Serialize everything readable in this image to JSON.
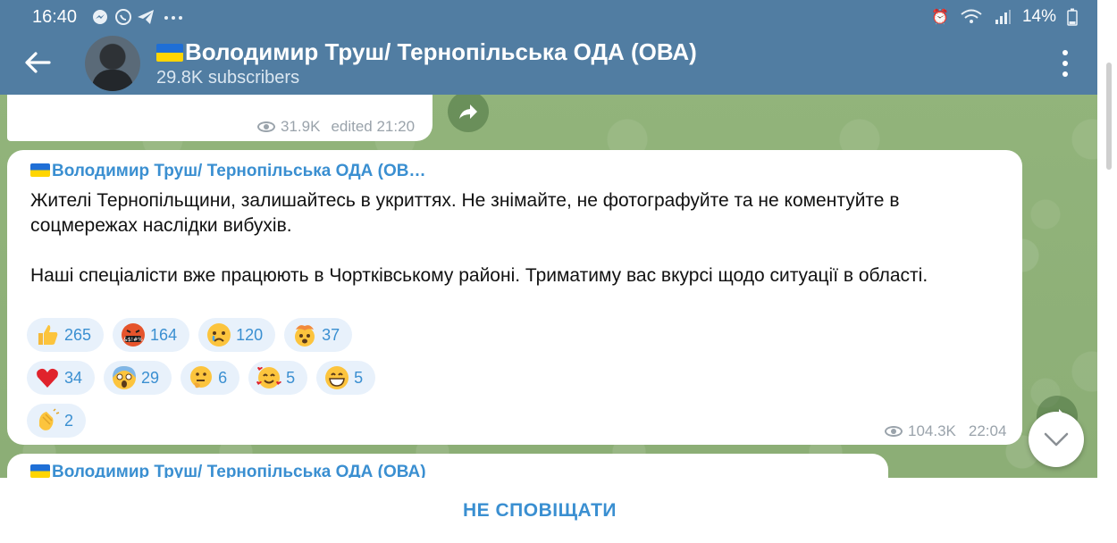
{
  "status_bar": {
    "time": "16:40",
    "apps": "messenger telegram-like chat telegram …",
    "battery": "14%"
  },
  "header": {
    "title": "Володимир Труш/ Тернопільська ОДА (ОВА)",
    "subscribers": "29.8K subscribers"
  },
  "previous_message": {
    "views": "31.9K",
    "edited": "edited 21:20"
  },
  "main_message": {
    "author": "Володимир Труш/ Тернопільська ОДА (ОВ…",
    "paragraph1": "Жителі Тернопільщини, залишайтесь в укриттях. Не знімайте, не фотографуйте та не коментуйте в соцмережах наслідки вибухів.",
    "paragraph2": "Наші спеціалісти вже працюють в Чортківському районі. Триматиму вас вкурсі щодо ситуації в області.",
    "reactions_row1": [
      {
        "emoji": "thumbs-up",
        "count": "265"
      },
      {
        "emoji": "cursing-face",
        "count": "164"
      },
      {
        "emoji": "crying-face",
        "count": "120"
      },
      {
        "emoji": "exploding-head",
        "count": "37"
      }
    ],
    "reactions_row2": [
      {
        "emoji": "red-heart",
        "count": "34"
      },
      {
        "emoji": "screaming-face",
        "count": "29"
      },
      {
        "emoji": "thinking-face",
        "count": "6"
      },
      {
        "emoji": "smiling-face-with-hearts",
        "count": "5"
      },
      {
        "emoji": "grinning-face",
        "count": "5"
      }
    ],
    "reactions_row3": [
      {
        "emoji": "clapping-hands",
        "count": "2"
      }
    ],
    "views": "104.3K",
    "time": "22:04"
  },
  "next_message": {
    "author": "Володимир Труш/ Тернопільська ОДА (ОВА)"
  },
  "bottom_bar": {
    "mute_label": "НЕ СПОВІЩАТИ"
  },
  "colors": {
    "header": "#517da2",
    "accent": "#3a8fd1",
    "chat_bg": "#8fb27a"
  }
}
